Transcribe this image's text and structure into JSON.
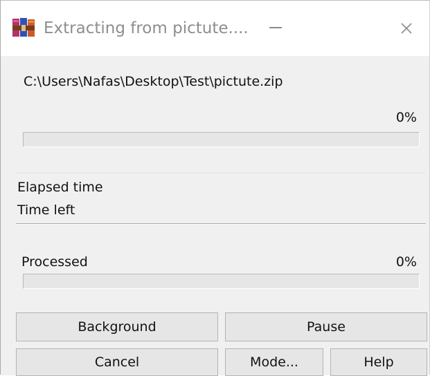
{
  "window": {
    "title": "Extracting from pictute....",
    "icon": "winrar-icon",
    "controls": {
      "minimize_icon": "minimize-icon",
      "close_icon": "close-icon"
    }
  },
  "archive": {
    "path": "C:\\Users\\Nafas\\Desktop\\Test\\pictute.zip",
    "file_percent": "0%",
    "file_progress": 0
  },
  "timing": {
    "elapsed_label": "Elapsed time",
    "time_left_label": "Time left"
  },
  "processed": {
    "label": "Processed",
    "percent": "0%",
    "progress": 0
  },
  "buttons": {
    "background": "Background",
    "pause": "Pause",
    "cancel": "Cancel",
    "mode": "Mode...",
    "help": "Help"
  },
  "colors": {
    "client_background": "#f0f0f0",
    "title_text": "#8e8e8e",
    "progress_fill": "#1f7a1f"
  }
}
